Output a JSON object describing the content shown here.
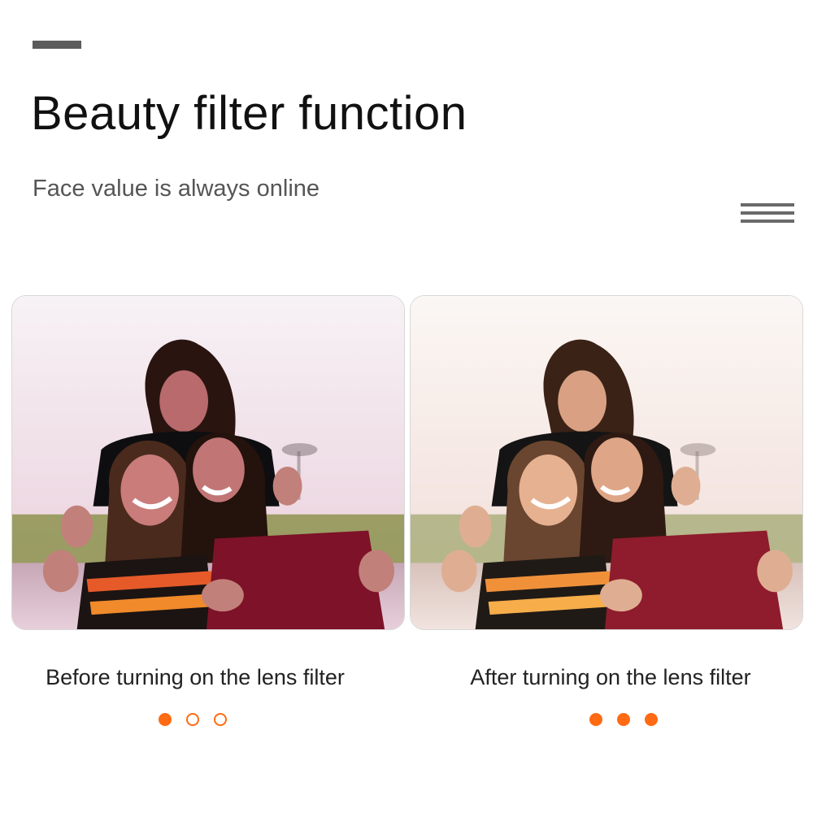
{
  "header": {
    "title": "Beauty filter function",
    "subtitle": "Face value is always online"
  },
  "comparison": {
    "before": {
      "caption": "Before turning on the lens filter",
      "dots": [
        "filled",
        "hollow",
        "hollow"
      ],
      "image_tone": "cool-magenta"
    },
    "after": {
      "caption": "After turning on the lens filter",
      "dots": [
        "filled",
        "filled",
        "filled"
      ],
      "image_tone": "warm-soft"
    }
  },
  "icons": {
    "top_bar": "dash-decoration",
    "menu": "menu-lines-icon"
  },
  "colors": {
    "accent": "#ff6a13",
    "title": "#111111",
    "subtitle": "#555555",
    "decoration": "#5c5c5c"
  }
}
